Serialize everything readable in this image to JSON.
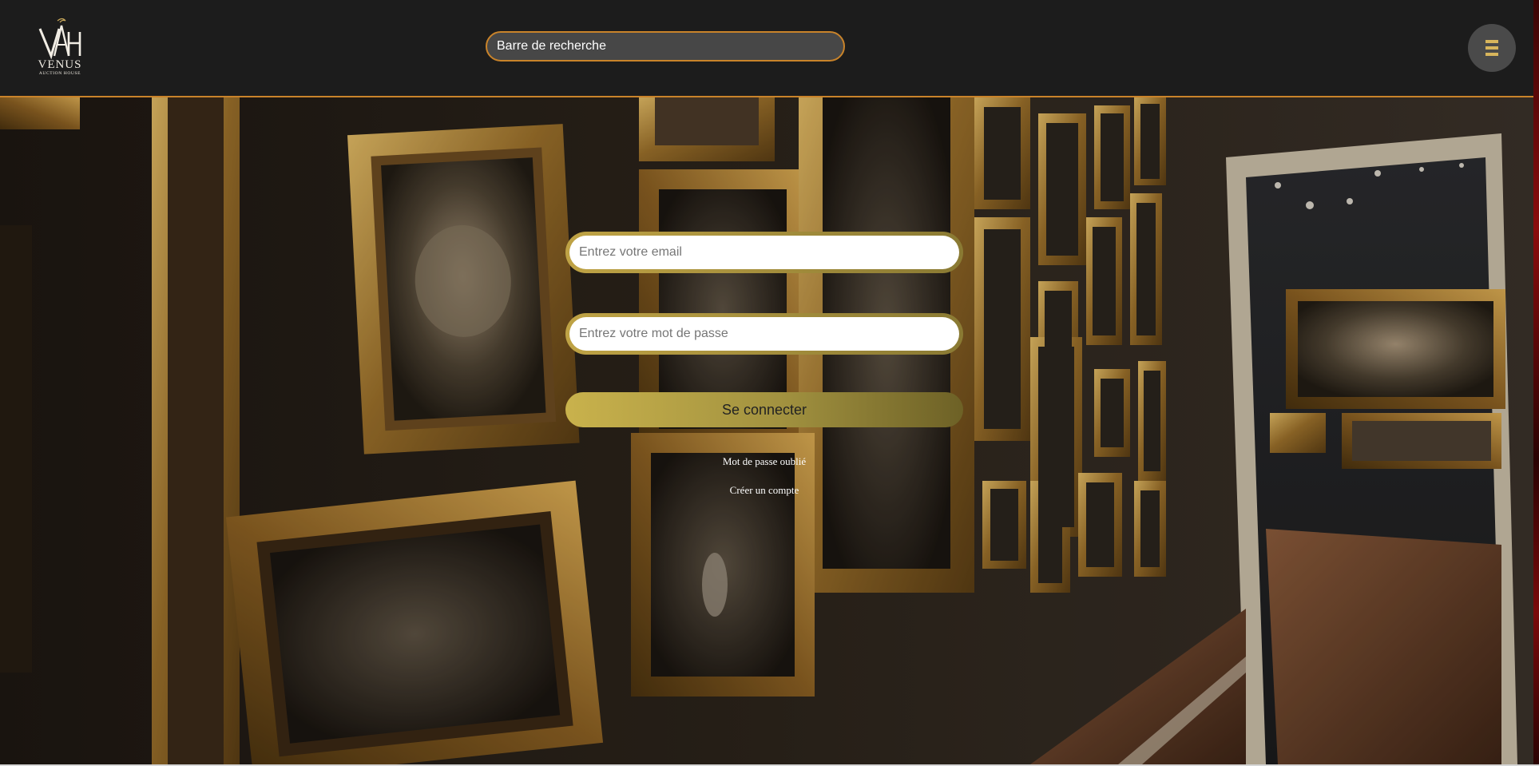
{
  "header": {
    "logo": {
      "monogram": "VAH",
      "name": "VENUS",
      "tagline": "AUCTION HOUSE",
      "icon": "venus-auction-house-logo"
    },
    "search": {
      "placeholder": "Barre de recherche"
    },
    "menu": {
      "icon": "hamburger-menu-icon"
    }
  },
  "login": {
    "email_placeholder": "Entrez votre email",
    "password_placeholder": "Entrez votre mot de passe",
    "submit_label": "Se connecter",
    "forgot_password_label": "Mot de passe oublié",
    "create_account_label": "Créer un compte"
  },
  "background": {
    "subject": "gallery-wall-of-gilded-frames"
  },
  "colors": {
    "header_bg": "#1c1c1c",
    "accent_orange": "#c9832a",
    "gold": "#c9b24c",
    "menu_bars": "#d7b55c",
    "search_bg": "#474747"
  }
}
